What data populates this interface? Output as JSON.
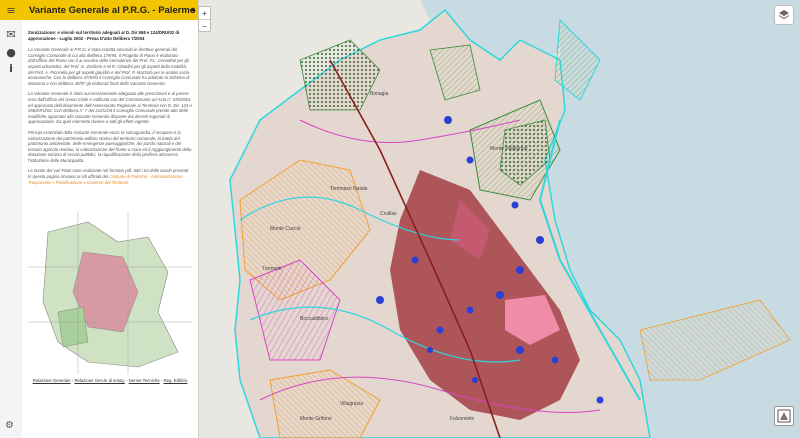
{
  "panel": {
    "title": "Variante Generale al P.R.G. - Palermo",
    "subtitle": "Zonizzazione: e vincoli sul territorio adeguati al D. Dir 558 e 124/DRU/02 di approvazione - Luglio 2002 - Presa D'atto Delibera 7/2004",
    "paragraph1": "La Variante Generale al P.R.G. è stata redatta secondo le direttive generali del Consiglio Comunale di cui alla delibera 179/94. Il Progetto di Piano è elaborato dall'Ufficio del Piano con il ai avvalso delle consulenze dei Prof. P.L. Cervellati per gli aspetti urbanistici, del Prof. G. Zanforin e M.R. Cittadini per gli aspetti della mobilità, del Prof. A. Piccirella per gli aspetti giuridici e del Prof. P. Mazzola per le analisi socio-economiche. Con la delibera 37/5/94 il Consiglio Comunale ha adottato lo Schema di Massima e con delibera 45/97 gli elaborati finali della Variante Generale.",
    "paragraph2": "La Variante Generale è stata successivamente adeguata alle prescrizioni e al parere reso dall'Ufficio del Genio Civile e ratificata con del Commissario ad Acta n° 470/2001 ed approvata definitivamente dall'Assessorato Regionale al Territorio con D. Dir. 124 e 558/DRU/02. Con delibera n° 7 del 21/01/04 il Consiglio Comunale prende atto delle modifiche apportate alla Variante Generale disposte dai decreti regionali di approvazione. Da quel momento divieve a tutti gli effetti vigente.",
    "paragraph3": "Principi essenziali della Variante Generale sono: la salvaguardia, il recupero e la valorizzazione del patrimonio edilizio storico del territorio comunale, la tutela del patrimonio ambientale, delle emergenze paesaggistiche, dei parchi naturali e del tessuto agricolo residuo, la valorizzazione del fronte a mare ed il raggiungimento della dotazione minima di servizi pubblici, la riqualificazione della periferia attraverso l'istituzione delle Municipalità.",
    "paragraph4_prefix": "Le tavole dei vari Piani sono realizzate nel formato pdf, tutti i tre delle tavole presenti in questa pagina rinviano ai siti ufficiali del",
    "paragraph4_link": "Comune di Palermo - Amministrazione Trasparente > Pianificazione e Governo del Territorio",
    "footer_links": [
      "Relazione Generale",
      "Relazione Gen.le di sotog.",
      "Norme Tecniche",
      "Reg. Edilizio"
    ]
  },
  "controls": {
    "zoom_in": "+",
    "zoom_out": "−",
    "collapse": "◂",
    "menu": "≡",
    "envelope": "✉",
    "github": "●",
    "info": "i",
    "gear": "⚙"
  },
  "map_labels": {
    "tommaso_natale": "Tommaso Natale",
    "tremonti": "Tremonti",
    "cruillas": "Cruillas",
    "villagrazia": "Villagrazia",
    "falsomiele": "Falsomiele",
    "monte_grifone": "Monte Grifone",
    "monte_cuccio": "Monte Cuccio",
    "monte_pellegrino": "Monte Pellegrino",
    "boccadifalco": "Boccadifalco",
    "bonagia": "Bonagia"
  },
  "icons": {
    "menu": "menu-icon",
    "collapse": "chevron-left-icon",
    "envelope": "envelope-icon",
    "github": "github-icon",
    "info": "info-icon",
    "layers": "layers-icon",
    "gear": "gear-icon",
    "logo": "logo-icon"
  },
  "colors": {
    "header": "#f3c400",
    "sea": "#c8dbe3",
    "land": "#e9e7e2",
    "urban_red": "#9b2a30",
    "cyan": "#2fd6e0",
    "magenta": "#d944c4",
    "orange": "#f2a02f",
    "blue_dot": "#2b3fd6",
    "green": "#3c8a3a"
  }
}
